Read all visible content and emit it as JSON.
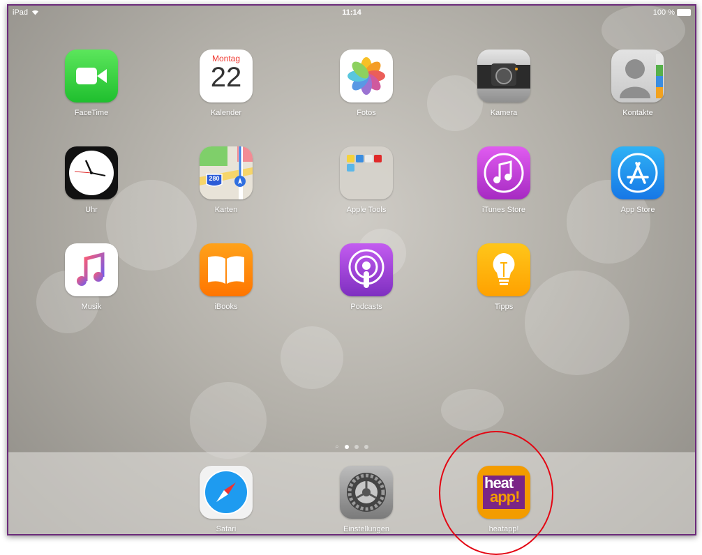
{
  "status_bar": {
    "device": "iPad",
    "time": "11:14",
    "battery": "100 %"
  },
  "home_grid": [
    {
      "label": "FaceTime",
      "icon": "facetime-icon"
    },
    {
      "label": "Kalender",
      "icon": "calendar-icon",
      "weekday": "Montag",
      "day": "22"
    },
    {
      "label": "Fotos",
      "icon": "photos-icon"
    },
    {
      "label": "Kamera",
      "icon": "camera-icon"
    },
    {
      "label": "Kontakte",
      "icon": "contacts-icon"
    },
    {
      "label": "Uhr",
      "icon": "clock-icon"
    },
    {
      "label": "Karten",
      "icon": "maps-icon",
      "road_sign": "280"
    },
    {
      "label": "Apple Tools",
      "icon": "folder-icon"
    },
    {
      "label": "iTunes Store",
      "icon": "itunes-icon"
    },
    {
      "label": "App Store",
      "icon": "appstore-icon"
    },
    {
      "label": "Musik",
      "icon": "music-icon"
    },
    {
      "label": "iBooks",
      "icon": "ibooks-icon"
    },
    {
      "label": "Podcasts",
      "icon": "podcasts-icon"
    },
    {
      "label": "Tipps",
      "icon": "tips-icon"
    }
  ],
  "dock": [
    {
      "label": "Safari",
      "icon": "safari-icon"
    },
    {
      "label": "Einstellungen",
      "icon": "settings-icon"
    },
    {
      "label": "heatapp!",
      "icon": "heatapp-icon",
      "logo_top": "heat",
      "logo_bottom": "app!"
    }
  ],
  "page_indicator": {
    "pages": 3,
    "current": 1
  },
  "colors": {
    "frame_border": "#6b2a7a",
    "annotation_circle": "#e30613",
    "facetime": "#2ecc40",
    "itunes": "#c43bd6",
    "appstore": "#1a8cf0",
    "podcasts": "#9b3fd0",
    "tips": "#ffb300",
    "ibooks": "#ff8a00",
    "heatapp": "#f39c00"
  }
}
